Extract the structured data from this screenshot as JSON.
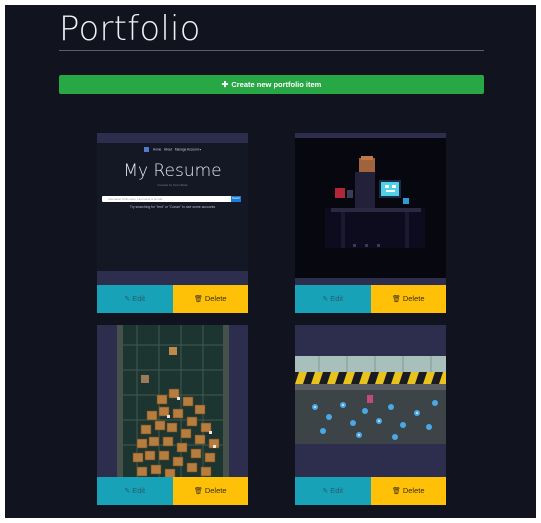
{
  "page": {
    "title": "Portfolio"
  },
  "create_button": {
    "label": "Create new portfolio item",
    "icon": "plus-icon"
  },
  "colors": {
    "background": "#11141e",
    "create": "#28a745",
    "edit": "#17a2b8",
    "delete": "#ffc107",
    "card": "#2d2e4d"
  },
  "cards": [
    {
      "edit_label": "Edit",
      "delete_label": "Delete",
      "resume": {
        "nav": [
          "Home",
          "About",
          "Manage Account ▾"
        ],
        "heading": "My Resume",
        "subtitle": "Created by Scott Bode",
        "search_placeholder": "Username, First name, Last name or E-mail",
        "search_button": "Search",
        "hint": "Try searching for \"test\" or \"Conan\" to see some accounts"
      }
    },
    {
      "edit_label": "Edit",
      "delete_label": "Delete"
    },
    {
      "edit_label": "Edit",
      "delete_label": "Delete"
    },
    {
      "edit_label": "Edit",
      "delete_label": "Delete"
    }
  ]
}
